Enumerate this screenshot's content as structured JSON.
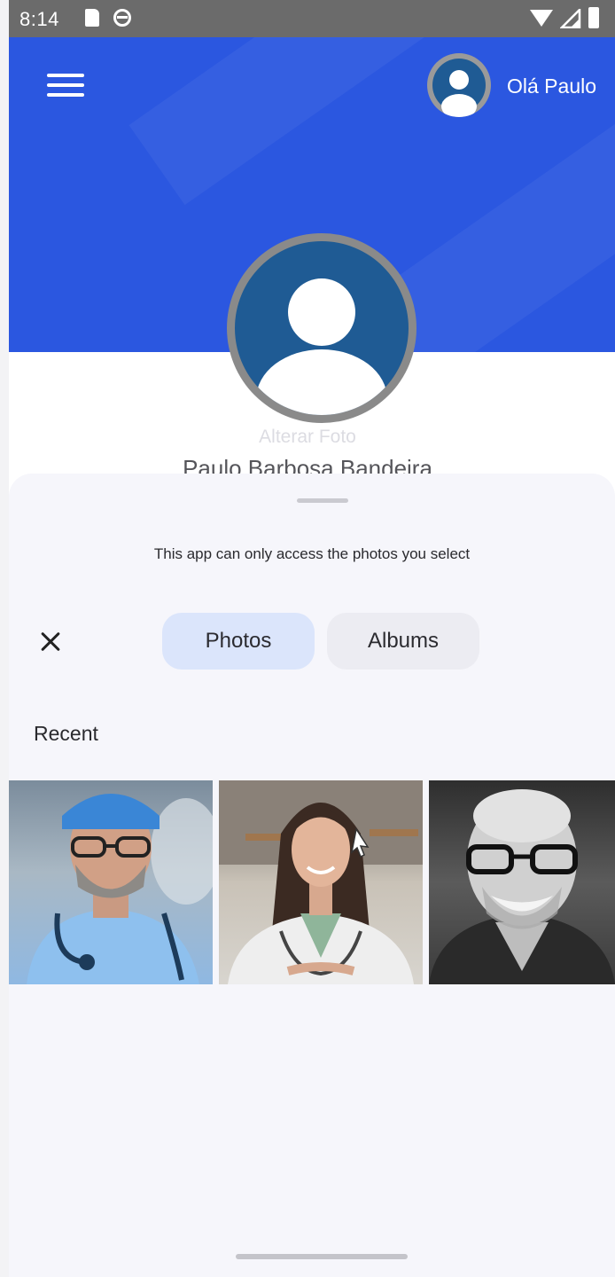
{
  "status_bar": {
    "time": "8:14"
  },
  "header": {
    "greeting": "Olá Paulo",
    "background_color": "#2b57e0"
  },
  "profile": {
    "change_photo_label": "Alterar Foto",
    "full_name": "Paulo Barbosa Bandeira"
  },
  "picker": {
    "access_note": "This app can only access the photos you select",
    "tabs": [
      {
        "label": "Photos",
        "selected": true
      },
      {
        "label": "Albums",
        "selected": false
      }
    ],
    "section_label": "Recent",
    "photos": [
      {
        "subject": "doctor-in-scrubs"
      },
      {
        "subject": "doctor-in-white-coat"
      },
      {
        "subject": "smiling-man-glasses"
      }
    ]
  },
  "colors": {
    "accent": "#2b57e0",
    "selected_tab": "#dbe5fb",
    "sheet_background": "#f6f6fb"
  }
}
